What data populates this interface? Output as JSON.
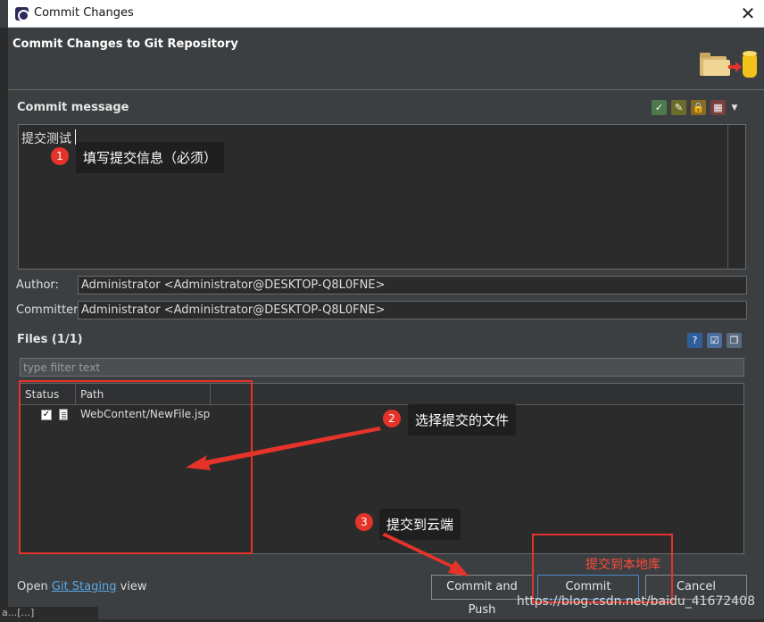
{
  "window": {
    "title": "Commit Changes",
    "close_glyph": "✕"
  },
  "banner": {
    "heading": "Commit Changes to Git Repository"
  },
  "commit_message": {
    "label": "Commit message",
    "text": "提交测试"
  },
  "author": {
    "label": "Author:",
    "value": "Administrator <Administrator@DESKTOP-Q8L0FNE>"
  },
  "committer": {
    "label": "Committer:",
    "value": "Administrator <Administrator@DESKTOP-Q8L0FNE>"
  },
  "files": {
    "label": "Files (1/1)",
    "filter_placeholder": "type filter text",
    "columns": [
      "Status",
      "Path"
    ],
    "rows": [
      {
        "checked": true,
        "path": "WebContent/NewFile.jsp"
      }
    ]
  },
  "footer": {
    "open_prefix": "Open ",
    "link": "Git Staging",
    "suffix": " view"
  },
  "buttons": {
    "commit_push": "Commit and Push",
    "commit": "Commit",
    "cancel": "Cancel"
  },
  "annotations": {
    "tip1": "填写提交信息（必须）",
    "tip2": "选择提交的文件",
    "tip3": "提交到云端",
    "local_label": "提交到本地库",
    "badge1": "1",
    "badge2": "2",
    "badge3": "3"
  },
  "watermark": "https://blog.csdn.net/baidu_41672408",
  "status_strip": "a...[...]",
  "colors": {
    "annotation_red": "#e5332a",
    "link_blue": "#5aa8e8",
    "dialog_bg": "#3c3f41"
  }
}
